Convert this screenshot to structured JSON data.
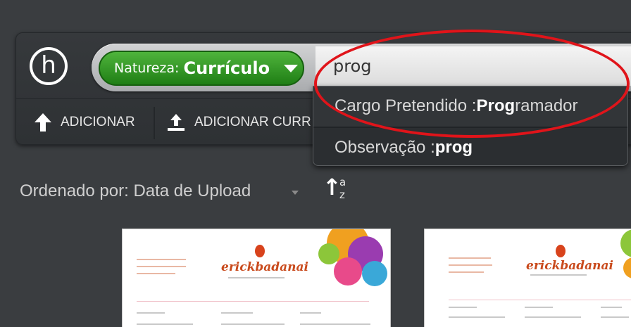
{
  "logo": {
    "letter": "h"
  },
  "filter": {
    "label": "Natureza:",
    "value": "Currículo"
  },
  "search": {
    "value": "prog"
  },
  "actions": [
    {
      "label": "ADICIONAR"
    },
    {
      "label": "ADICIONAR CURR"
    }
  ],
  "suggestions": [
    {
      "field": "Cargo Pretendido : ",
      "match": "Prog",
      "rest": "ramador"
    },
    {
      "field": "Observação : ",
      "match": "prog",
      "rest": ""
    }
  ],
  "sort": {
    "label": "Ordenado por: Data de Upload",
    "dir_top": "a",
    "dir_bottom": "z"
  },
  "thumbnails": [
    {
      "brand": "erickbadanai"
    },
    {
      "brand": "erickbadanai"
    }
  ],
  "colors": {
    "accent_green": "#2e9a22",
    "highlight_red": "#e0141a",
    "background": "#3a3d40"
  }
}
